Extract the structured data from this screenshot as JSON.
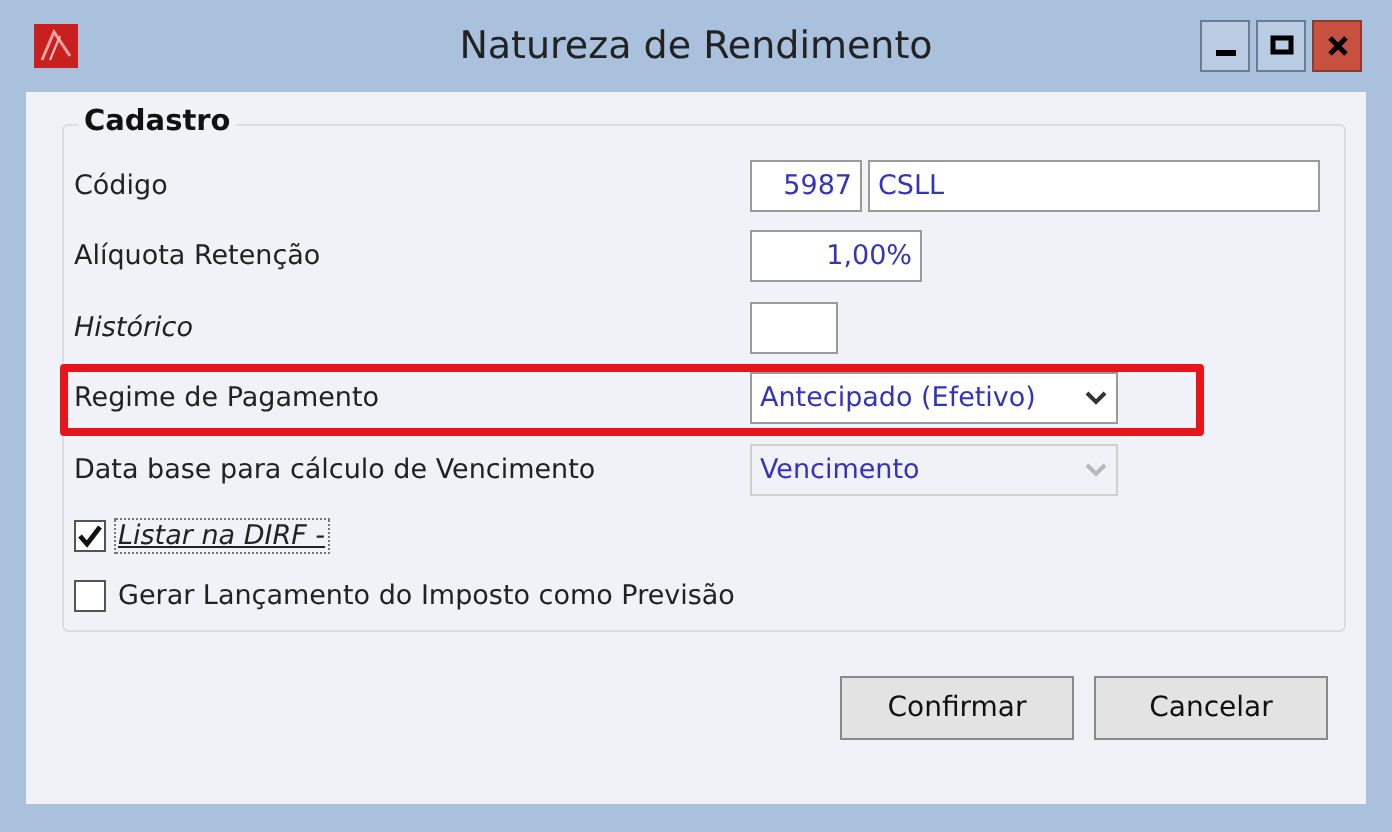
{
  "window": {
    "title": "Natureza de Rendimento"
  },
  "group": {
    "title": "Cadastro"
  },
  "fields": [
    {
      "kind": "code",
      "label": "Código",
      "italic": false,
      "value": "5987",
      "value_2": "CSLL"
    },
    {
      "kind": "rate",
      "label": "Alíquota Retenção",
      "italic": false,
      "value": "1,00%"
    },
    {
      "kind": "blank",
      "label": "Histórico",
      "italic": true
    },
    {
      "kind": "select",
      "label": "Regime de Pagamento",
      "italic": false,
      "value": "Antecipado (Efetivo)",
      "disabled": false,
      "highlighted": true
    },
    {
      "kind": "select",
      "label": "Data base para cálculo de Vencimento",
      "italic": false,
      "value": "Vencimento",
      "disabled": true
    }
  ],
  "checkboxes": [
    {
      "label": "Listar na DIRF -",
      "checked": true,
      "focused": true
    },
    {
      "label": "Gerar Lançamento do Imposto como Previsão",
      "checked": false,
      "focused": false
    }
  ],
  "buttons": [
    "Confirmar",
    "Cancelar"
  ]
}
